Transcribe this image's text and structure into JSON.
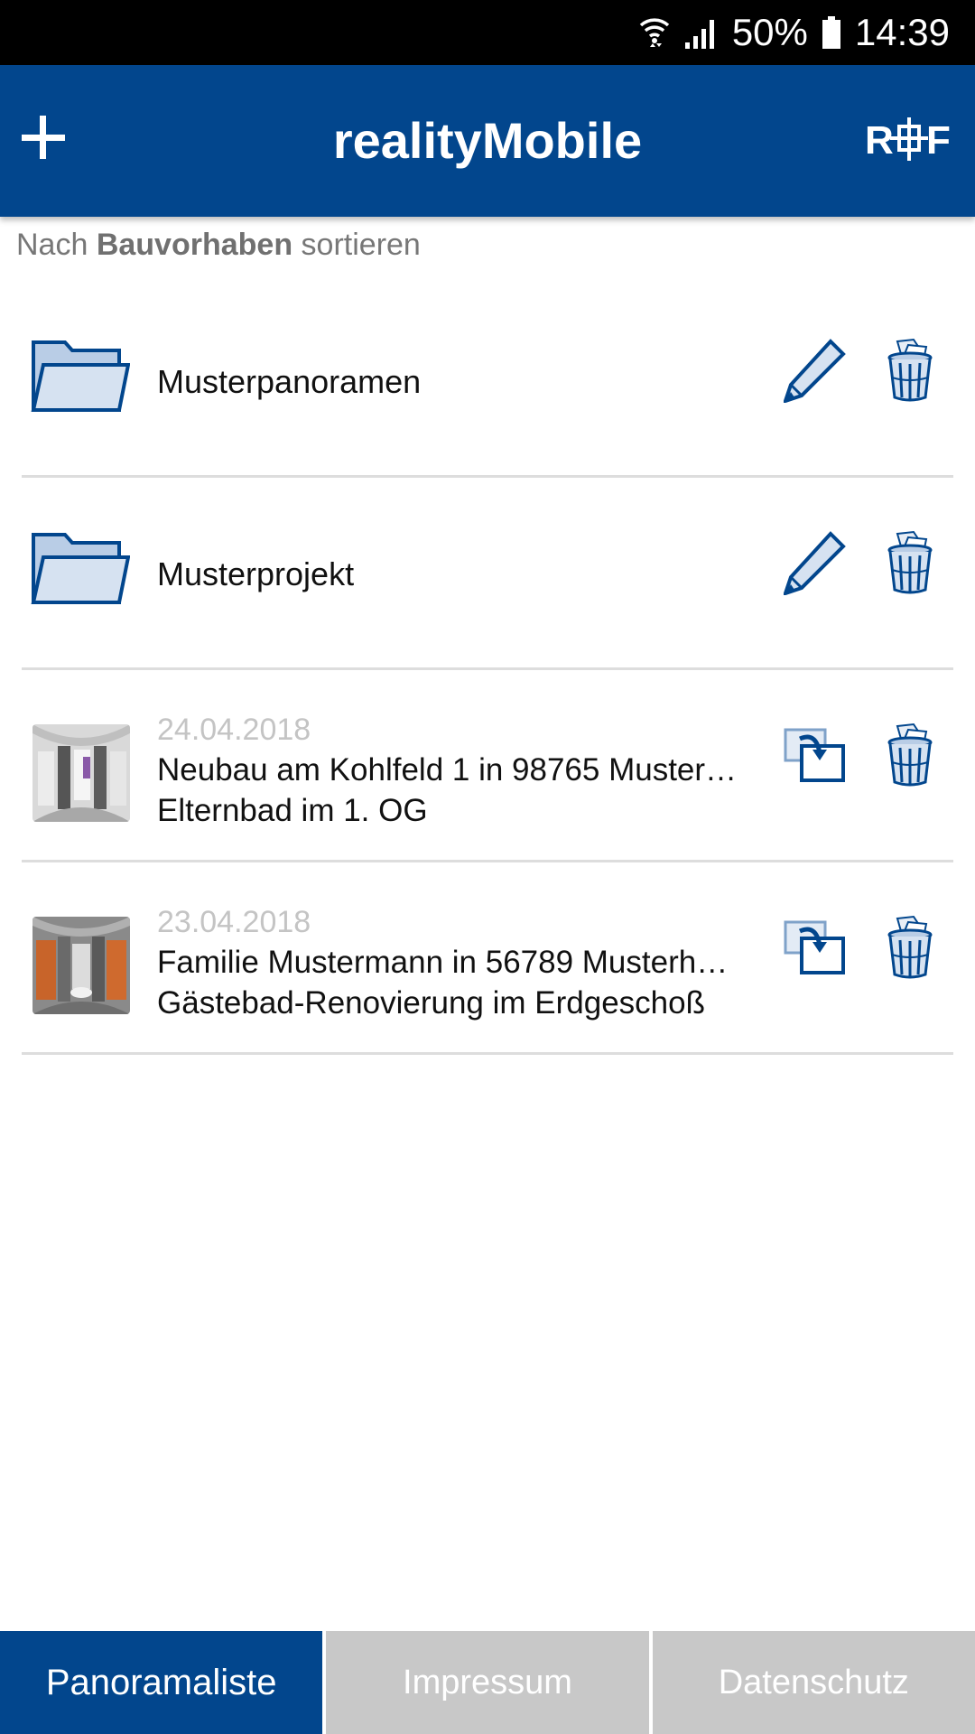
{
  "status_bar": {
    "battery": "50%",
    "time": "14:39"
  },
  "app_bar": {
    "title": "realityMobile",
    "logo_text": "R+F",
    "accent": "#02468d"
  },
  "sort": {
    "prefix": "Nach",
    "field": "Bauvorhaben",
    "suffix": "sortieren"
  },
  "list": [
    {
      "type": "folder",
      "name": "Musterpanoramen",
      "icon": "folder-icon",
      "actions": [
        "pencil-icon",
        "trash-icon"
      ]
    },
    {
      "type": "folder",
      "name": "Musterprojekt",
      "icon": "folder-icon",
      "actions": [
        "pencil-icon",
        "trash-icon"
      ]
    },
    {
      "type": "panorama",
      "date": "24.04.2018",
      "title": "Neubau am Kohlfeld 1 in 98765 Muster…",
      "subtitle": "Elternbad im 1. OG",
      "actions": [
        "move-icon",
        "trash-icon"
      ]
    },
    {
      "type": "panorama",
      "date": "23.04.2018",
      "title": "Familie Mustermann in 56789 Musterh…",
      "subtitle": "Gästebad-Renovierung im Erdgeschoß",
      "actions": [
        "move-icon",
        "trash-icon"
      ]
    }
  ],
  "tabs": [
    {
      "label": "Panoramaliste",
      "active": true
    },
    {
      "label": "Impressum",
      "active": false
    },
    {
      "label": "Datenschutz",
      "active": false
    }
  ]
}
